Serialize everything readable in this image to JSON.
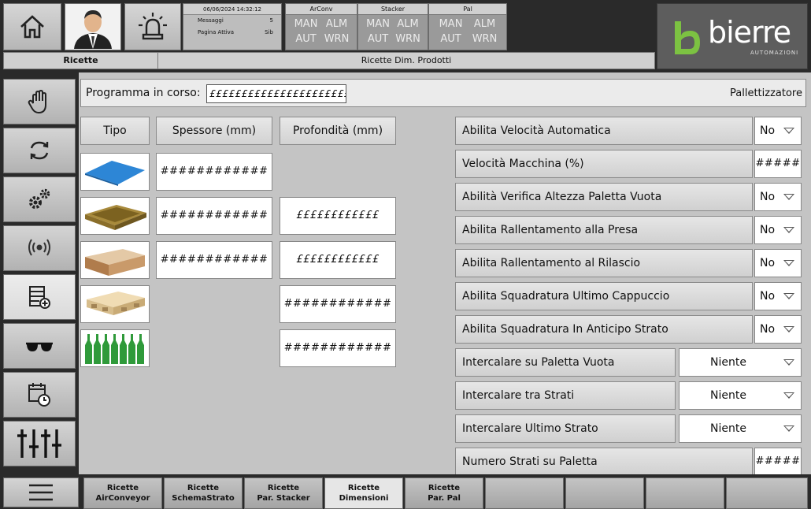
{
  "header": {
    "datetime": "06/06/2024 14:32:12",
    "info_rows": [
      {
        "label": "Messaggi",
        "value": "5"
      },
      {
        "label": "Pagina Attiva",
        "value": "Sib"
      }
    ],
    "stations": [
      {
        "name": "ArConv",
        "states": [
          "MAN",
          "ALM",
          "AUT",
          "WRN"
        ]
      },
      {
        "name": "Stacker",
        "states": [
          "MAN",
          "ALM",
          "AUT",
          "WRN"
        ]
      },
      {
        "name": "Pal",
        "states": [
          "MAN",
          "ALM",
          "AUT",
          "WRN"
        ]
      }
    ],
    "breadcrumb_left": "Ricette",
    "breadcrumb_right": "Ricette Dim. Prodotti"
  },
  "logo": {
    "word": "bierre",
    "sub": "AUTOMAZIONI"
  },
  "program": {
    "label": "Programma in corso:",
    "value": "££££££££££££££££££££££££",
    "section": "Pallettizzatore"
  },
  "columns": {
    "tipo": "Tipo",
    "spessore": "Spessore (mm)",
    "profondita": "Profondità (mm)"
  },
  "products": [
    {
      "spessore": "############",
      "profondita": ""
    },
    {
      "spessore": "############",
      "profondita": "££££££££££££"
    },
    {
      "spessore": "############",
      "profondita": "££££££££££££"
    },
    {
      "spessore": "",
      "profondita": "############"
    },
    {
      "spessore": "",
      "profondita": "############"
    }
  ],
  "params": [
    {
      "label": "Abilita Velocità Automatica",
      "value": "No",
      "kind": "small"
    },
    {
      "label": "Velocità Macchina (%)",
      "value": "#####",
      "kind": "num"
    },
    {
      "label": "Abilità Verifica Altezza Paletta Vuota",
      "value": "No",
      "kind": "small"
    },
    {
      "label": "Abilita Rallentamento alla Presa",
      "value": "No",
      "kind": "small"
    },
    {
      "label": "Abilita Rallentamento al Rilascio",
      "value": "No",
      "kind": "small"
    },
    {
      "label": "Abilita Squadratura Ultimo Cappuccio",
      "value": "No",
      "kind": "small"
    },
    {
      "label": "Abilita Squadratura In Anticipo Strato",
      "value": "No",
      "kind": "small"
    },
    {
      "label": "Intercalare su Paletta Vuota",
      "value": "Niente",
      "kind": "wide"
    },
    {
      "label": "Intercalare tra Strati",
      "value": "Niente",
      "kind": "wide"
    },
    {
      "label": "Intercalare Ultimo Strato",
      "value": "Niente",
      "kind": "wide"
    },
    {
      "label": "Numero Strati su Paletta",
      "value": "#####",
      "kind": "num"
    }
  ],
  "tabs": [
    {
      "line1": "Ricette",
      "line2": "AirConveyor"
    },
    {
      "line1": "Ricette",
      "line2": "SchemaStrato"
    },
    {
      "line1": "Ricette",
      "line2": "Par. Stacker"
    },
    {
      "line1": "Ricette",
      "line2": "Dimensioni"
    },
    {
      "line1": "Ricette",
      "line2": "Par. Pal"
    }
  ],
  "active_tab": 3,
  "sidebar_icons": [
    "hand-icon",
    "cycle-icon",
    "gears-icon",
    "signal-icon",
    "recipe-icon",
    "glasses-icon",
    "calendar-clock-icon",
    "sliders-icon"
  ],
  "colors": {
    "accent_green": "#7cc242",
    "panel": "#c4c4c4",
    "dark": "#2a2a2a"
  }
}
